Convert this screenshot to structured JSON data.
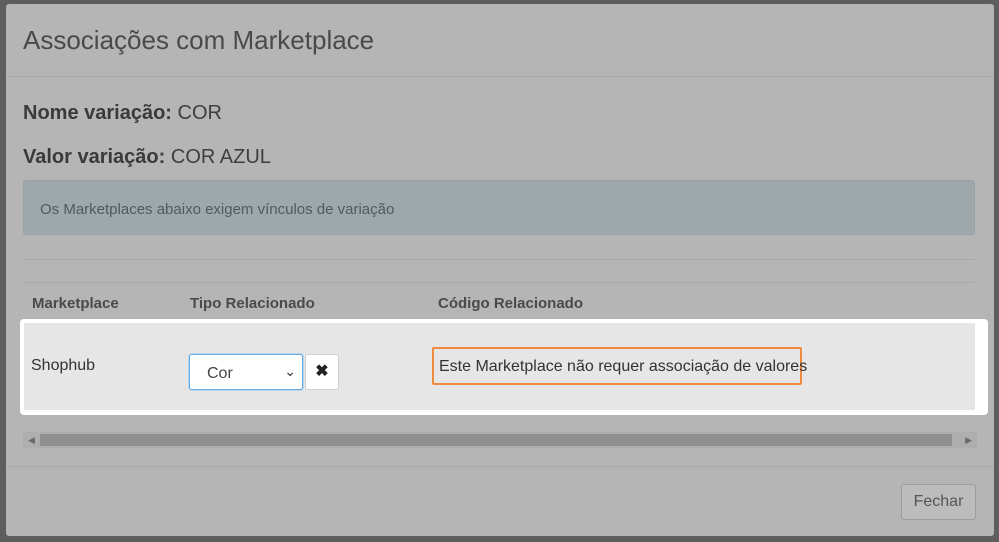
{
  "modal": {
    "title": "Associações com Marketplace",
    "nome_variacao_label": "Nome variação:",
    "nome_variacao_value": "COR",
    "valor_variacao_label": "Valor variação:",
    "valor_variacao_value": "COR AZUL",
    "alert_text": "Os Marketplaces abaixo exigem vínculos de variação"
  },
  "table": {
    "headers": [
      "Marketplace",
      "Tipo Relacionado",
      "Código Relacionado"
    ],
    "rows": [
      {
        "marketplace": "Shophub",
        "tipo_selected": "Cor",
        "remove_symbol": "✖",
        "codigo_text": "Este Marketplace não requer associação de valores"
      }
    ]
  },
  "footer": {
    "close_label": "Fechar"
  },
  "colors": {
    "highlight_border": "#ef8a3e",
    "select_focus": "#66aee8"
  }
}
